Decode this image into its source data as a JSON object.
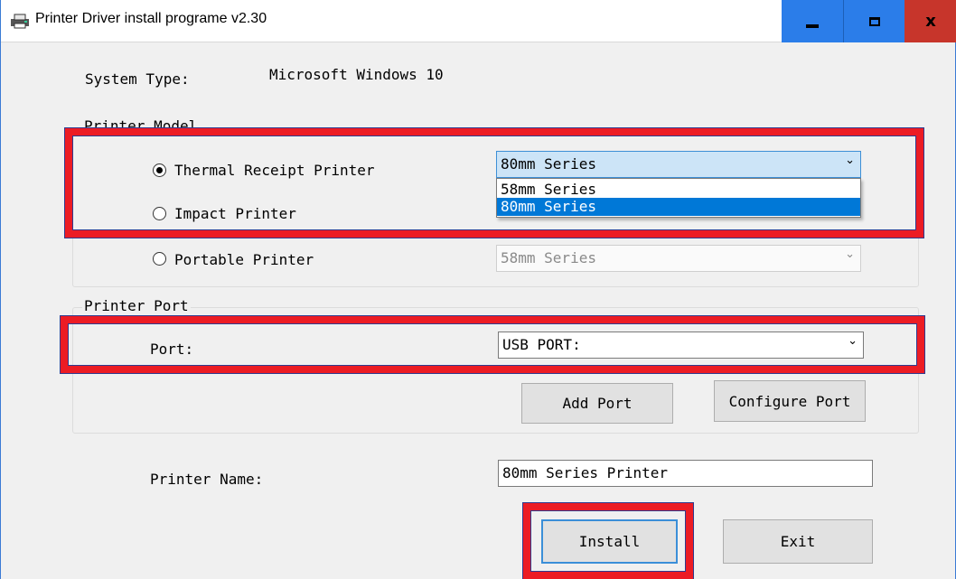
{
  "window": {
    "title": "Printer Driver install programe v2.30",
    "icon": "printer-icon",
    "controls": {
      "minimize": "minimize-icon",
      "maximize": "maximize-icon",
      "close": "x"
    }
  },
  "system": {
    "label": "System Type:",
    "value": "Microsoft Windows 10"
  },
  "model_group": {
    "legend": "Printer Model",
    "options": [
      {
        "label": "Thermal Receipt Printer",
        "checked": true
      },
      {
        "label": "Impact Printer",
        "checked": false
      },
      {
        "label": "Portable Printer",
        "checked": false
      }
    ],
    "thermal_combo": {
      "value": "80mm Series",
      "open": true,
      "items": [
        "58mm Series",
        "80mm Series"
      ],
      "selected_index": 1
    },
    "portable_combo": {
      "value": "58mm Series",
      "enabled": false
    }
  },
  "port_group": {
    "legend": "Printer Port",
    "label": "Port:",
    "combo_value": "USB PORT:",
    "add_port": "Add Port",
    "configure_port": "Configure Port"
  },
  "printer_name": {
    "label": "Printer Name:",
    "value": "80mm Series Printer"
  },
  "actions": {
    "install": "Install",
    "exit": "Exit"
  },
  "colors": {
    "highlight": "#ec1c24",
    "highlight_outline": "#2e3b8f",
    "title_buttons": "#2b7de9",
    "close_button": "#c7352b",
    "selection": "#0078d7"
  }
}
